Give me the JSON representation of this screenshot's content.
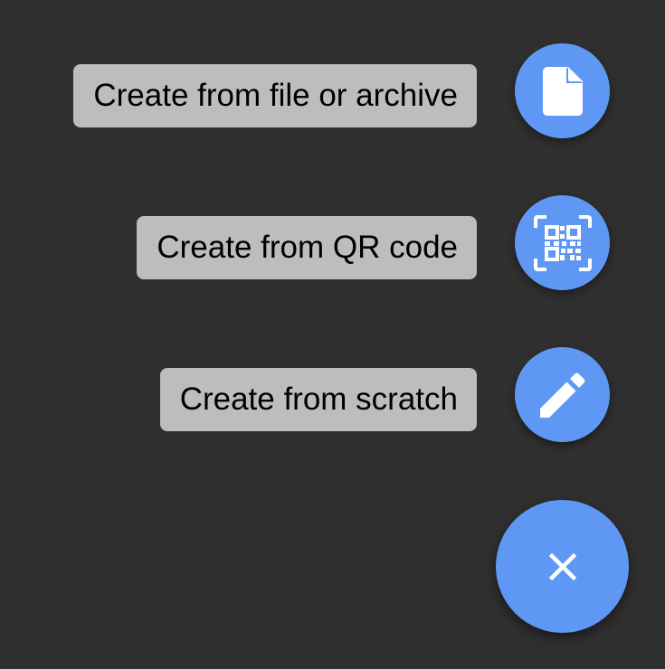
{
  "theme": {
    "background": "#303030",
    "accent": "#5f98f4",
    "label_background": "#bdbdbd",
    "label_text": "#000000",
    "icon_color": "#ffffff"
  },
  "speed_dial": {
    "actions": [
      {
        "label": "Create from file or archive",
        "icon": "file-icon"
      },
      {
        "label": "Create from QR code",
        "icon": "qr-code-scan-icon"
      },
      {
        "label": "Create from scratch",
        "icon": "pencil-icon"
      }
    ],
    "main_button": {
      "icon": "close-icon"
    }
  }
}
